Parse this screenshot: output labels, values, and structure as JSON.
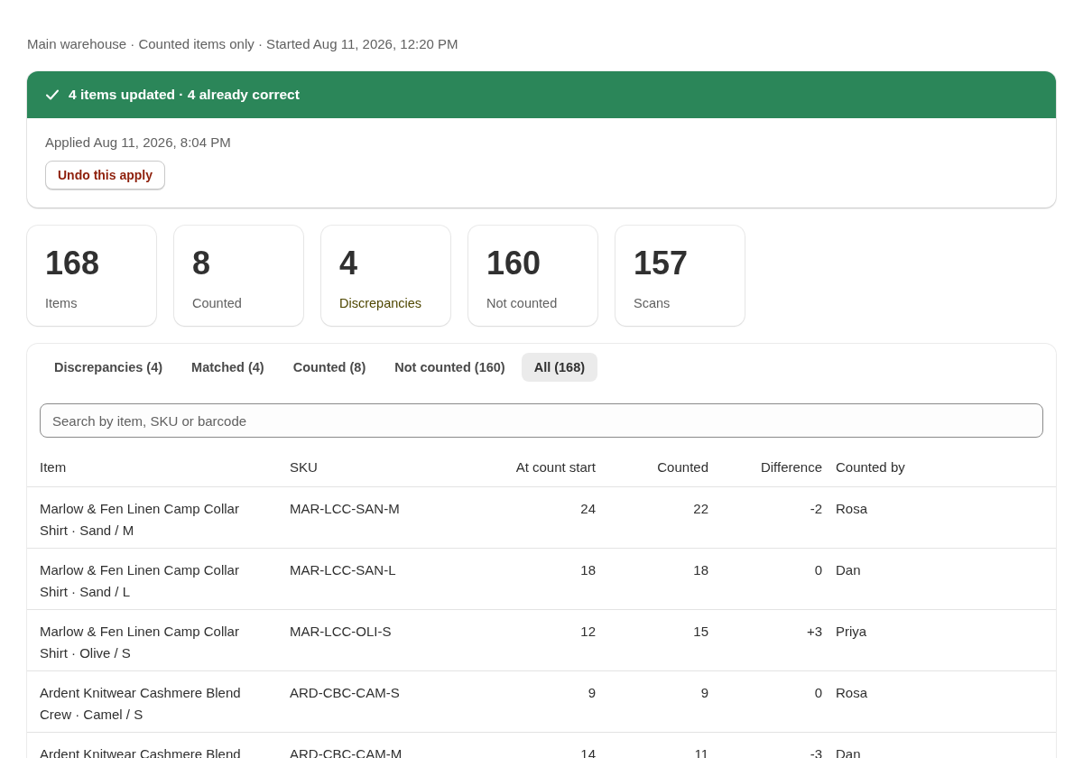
{
  "subtitle": "Main warehouse · Counted items only · Started Aug 11, 2026, 12:20 PM",
  "banner": {
    "title": "4 items updated · 4 already correct",
    "applied": "Applied Aug 11, 2026, 8:04 PM",
    "undo_button": "Undo this apply"
  },
  "stats": [
    {
      "value": "168",
      "label": "Items",
      "highlight": false
    },
    {
      "value": "8",
      "label": "Counted",
      "highlight": false
    },
    {
      "value": "4",
      "label": "Discrepancies",
      "highlight": true
    },
    {
      "value": "160",
      "label": "Not counted",
      "highlight": false
    },
    {
      "value": "157",
      "label": "Scans",
      "highlight": false
    }
  ],
  "tabs": [
    {
      "label": "Discrepancies (4)",
      "selected": false
    },
    {
      "label": "Matched (4)",
      "selected": false
    },
    {
      "label": "Counted (8)",
      "selected": false
    },
    {
      "label": "Not counted (160)",
      "selected": false
    },
    {
      "label": "All (168)",
      "selected": true
    }
  ],
  "search": {
    "placeholder": "Search by item, SKU or barcode"
  },
  "table": {
    "columns": [
      "Item",
      "SKU",
      "At count start",
      "Counted",
      "Difference",
      "Counted by"
    ],
    "rows": [
      [
        "Marlow & Fen Linen Camp Collar Shirt · Sand / M",
        "MAR-LCC-SAN-M",
        "24",
        "22",
        "-2",
        "Rosa"
      ],
      [
        "Marlow & Fen Linen Camp Collar Shirt · Sand / L",
        "MAR-LCC-SAN-L",
        "18",
        "18",
        "0",
        "Dan"
      ],
      [
        "Marlow & Fen Linen Camp Collar Shirt · Olive / S",
        "MAR-LCC-OLI-S",
        "12",
        "15",
        "+3",
        "Priya"
      ],
      [
        "Ardent Knitwear Cashmere Blend Crew · Camel / S",
        "ARD-CBC-CAM-S",
        "9",
        "9",
        "0",
        "Rosa"
      ],
      [
        "Ardent Knitwear Cashmere Blend",
        "ARD-CBC-CAM-M",
        "14",
        "11",
        "-3",
        "Dan"
      ]
    ]
  }
}
